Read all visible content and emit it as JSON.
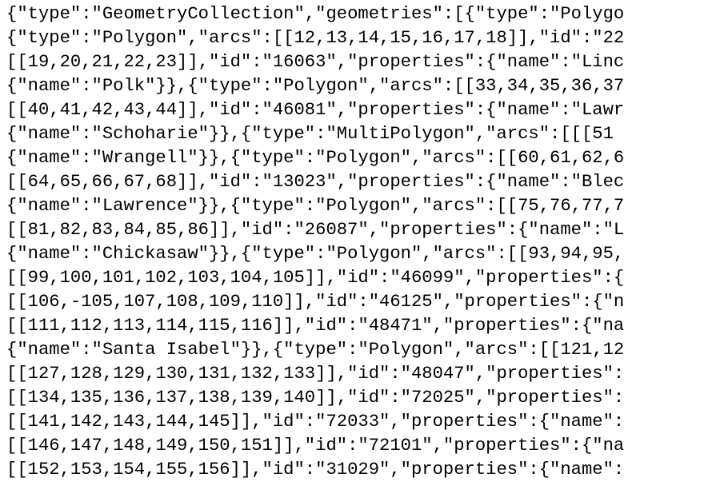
{
  "document": {
    "lines": [
      "{\"type\":\"GeometryCollection\",\"geometries\":[{\"type\":\"Polygo",
      "{\"type\":\"Polygon\",\"arcs\":[[12,13,14,15,16,17,18]],\"id\":\"22",
      "[[19,20,21,22,23]],\"id\":\"16063\",\"properties\":{\"name\":\"Linc",
      "{\"name\":\"Polk\"}},{\"type\":\"Polygon\",\"arcs\":[[33,34,35,36,37",
      "[[40,41,42,43,44]],\"id\":\"46081\",\"properties\":{\"name\":\"Lawr",
      "{\"name\":\"Schoharie\"}},{\"type\":\"MultiPolygon\",\"arcs\":[[[51",
      "{\"name\":\"Wrangell\"}},{\"type\":\"Polygon\",\"arcs\":[[60,61,62,6",
      "[[64,65,66,67,68]],\"id\":\"13023\",\"properties\":{\"name\":\"Blec",
      "{\"name\":\"Lawrence\"}},{\"type\":\"Polygon\",\"arcs\":[[75,76,77,7",
      "[[81,82,83,84,85,86]],\"id\":\"26087\",\"properties\":{\"name\":\"L",
      "{\"name\":\"Chickasaw\"}},{\"type\":\"Polygon\",\"arcs\":[[93,94,95,",
      "[[99,100,101,102,103,104,105]],\"id\":\"46099\",\"properties\":{",
      "[[106,-105,107,108,109,110]],\"id\":\"46125\",\"properties\":{\"n",
      "[[111,112,113,114,115,116]],\"id\":\"48471\",\"properties\":{\"na",
      "{\"name\":\"Santa Isabel\"}},{\"type\":\"Polygon\",\"arcs\":[[121,12",
      "[[127,128,129,130,131,132,133]],\"id\":\"48047\",\"properties\":",
      "[[134,135,136,137,138,139,140]],\"id\":\"72025\",\"properties\":",
      "[[141,142,143,144,145]],\"id\":\"72033\",\"properties\":{\"name\":",
      "[[146,147,148,149,150,151]],\"id\":\"72101\",\"properties\":{\"na",
      "[[152,153,154,155,156]],\"id\":\"31029\",\"properties\":{\"name\":"
    ]
  }
}
